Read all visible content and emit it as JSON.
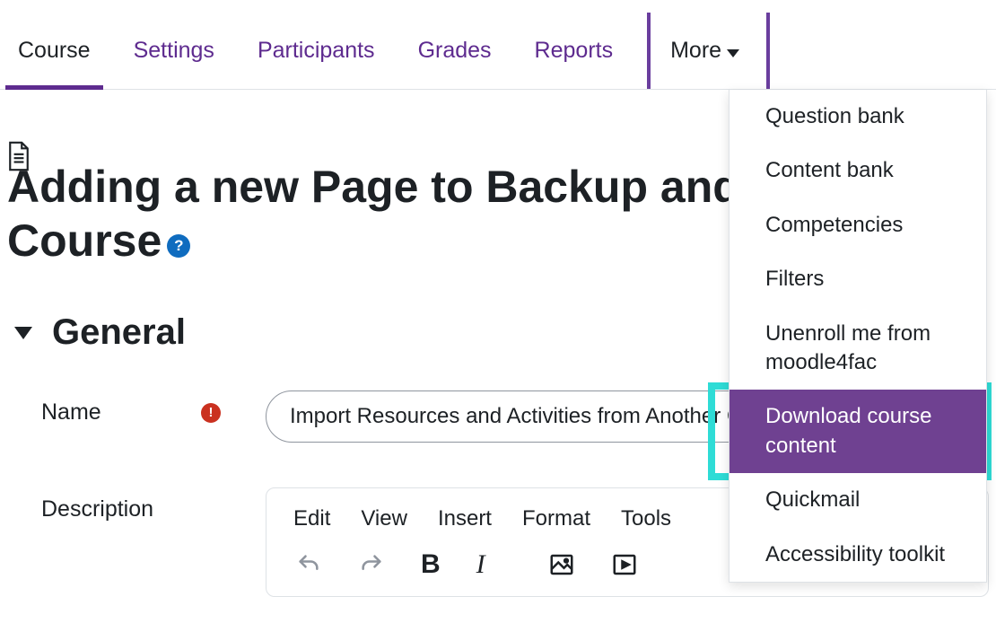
{
  "tabs": {
    "course": "Course",
    "settings": "Settings",
    "participants": "Participants",
    "grades": "Grades",
    "reports": "Reports",
    "more": "More"
  },
  "page": {
    "title": "Adding a new Page to Backup and Restore a Course"
  },
  "section": {
    "title": "General"
  },
  "form": {
    "name_label": "Name",
    "name_value": "Import Resources and Activities from Another Course",
    "description_label": "Description"
  },
  "editor": {
    "menu": {
      "edit": "Edit",
      "view": "View",
      "insert": "Insert",
      "format": "Format",
      "tools": "Tools"
    }
  },
  "dropdown": {
    "question_bank": "Question bank",
    "content_bank": "Content bank",
    "competencies": "Competencies",
    "filters": "Filters",
    "unenroll": "Unenroll me from moodle4fac",
    "download": "Download course content",
    "quickmail": "Quickmail",
    "accessibility": "Accessibility toolkit"
  }
}
